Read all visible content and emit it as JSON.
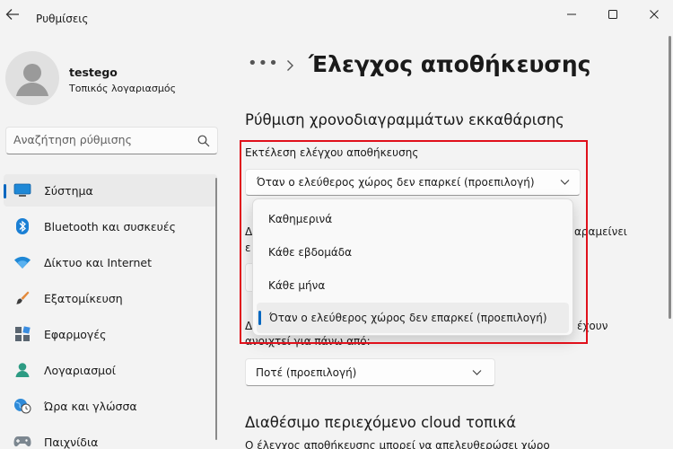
{
  "window": {
    "app_title": "Ρυθμίσεις"
  },
  "profile": {
    "name": "testego",
    "account_type": "Τοπικός λογαριασμός"
  },
  "search": {
    "placeholder": "Αναζήτηση ρύθμισης"
  },
  "sidebar": {
    "items": [
      {
        "label": "Σύστημα",
        "icon": "system-icon",
        "active": true
      },
      {
        "label": "Bluetooth και συσκευές",
        "icon": "bluetooth-icon"
      },
      {
        "label": "Δίκτυο και Internet",
        "icon": "wifi-icon"
      },
      {
        "label": "Εξατομίκευση",
        "icon": "brush-icon"
      },
      {
        "label": "Εφαρμογές",
        "icon": "apps-icon"
      },
      {
        "label": "Λογαριασμοί",
        "icon": "account-icon"
      },
      {
        "label": "Ώρα και γλώσσα",
        "icon": "globe-icon"
      },
      {
        "label": "Παιχνίδια",
        "icon": "gamepad-icon"
      }
    ]
  },
  "breadcrumb": {
    "more": "•••",
    "title": "Έλεγχος αποθήκευσης"
  },
  "main": {
    "section_title": "Ρύθμιση χρονοδιαγραμμάτων εκκαθάρισης",
    "run_label": "Εκτέλεση ελέγχου αποθήκευσης",
    "run_value": "Όταν ο ελεύθερος χώρος δεν επαρκεί (προεπιλογή)",
    "partial_text_1_left": "Δ",
    "partial_text_1_right": "αραμείνει",
    "partial_text_1_line2": "ε",
    "partial_text_2_left": "Δ",
    "partial_text_2_right": "έχουν",
    "partial_text_2_line2": "ανοιχτεί για πάνω από:",
    "downloads_value": "Ποτέ (προεπιλογή)",
    "section2_title": "Διαθέσιμο περιεχόμενο cloud τοπικά",
    "section2_desc": "Ο έλεγχος αποθήκευσης μπορεί να απελευθερώσει χώρο"
  },
  "dropdown": {
    "options": [
      {
        "label": "Καθημερινά",
        "selected": false
      },
      {
        "label": "Κάθε εβδομάδα",
        "selected": false
      },
      {
        "label": "Κάθε μήνα",
        "selected": false
      },
      {
        "label": "Όταν ο ελεύθερος χώρος δεν επαρκεί (προεπιλογή)",
        "selected": true
      }
    ]
  },
  "colors": {
    "accent": "#0067c0",
    "highlight": "#e0101b",
    "background": "#f3f3f3"
  }
}
